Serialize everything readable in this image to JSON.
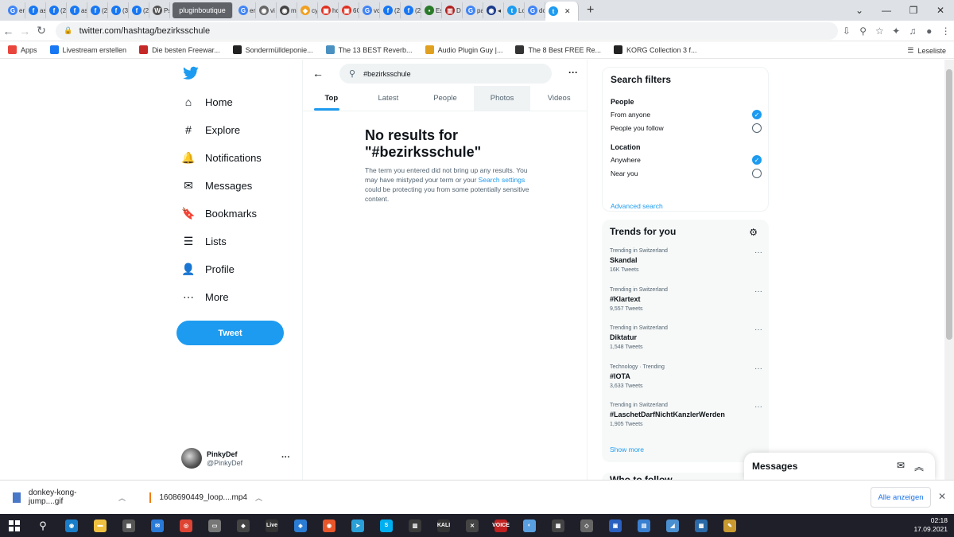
{
  "browser": {
    "tabs": [
      {
        "fav": "G",
        "label": "er",
        "color": "#4285f4"
      },
      {
        "fav": "f",
        "label": "as",
        "color": "#1877f2"
      },
      {
        "fav": "f",
        "label": "(2",
        "color": "#1877f2"
      },
      {
        "fav": "f",
        "label": "as",
        "color": "#1877f2"
      },
      {
        "fav": "f",
        "label": "(2",
        "color": "#1877f2"
      },
      {
        "fav": "f",
        "label": "(3",
        "color": "#1877f2"
      },
      {
        "fav": "f",
        "label": "(2",
        "color": "#1877f2"
      },
      {
        "fav": "W",
        "label": "Ps",
        "color": "#555555"
      }
    ],
    "highlight_tab": "pluginboutique",
    "tabs2": [
      {
        "fav": "G",
        "label": "er",
        "color": "#4285f4"
      },
      {
        "fav": "◉",
        "label": "vi",
        "color": "#666666"
      },
      {
        "fav": "◉",
        "label": "m",
        "color": "#444444"
      },
      {
        "fav": "◆",
        "label": "cy",
        "color": "#f0a020"
      },
      {
        "fav": "▣",
        "label": "hc",
        "color": "#e03020"
      },
      {
        "fav": "▣",
        "label": "6C",
        "color": "#e03020"
      },
      {
        "fav": "G",
        "label": "vc",
        "color": "#4285f4"
      },
      {
        "fav": "f",
        "label": "(2",
        "color": "#1877f2"
      },
      {
        "fav": "f",
        "label": "(2",
        "color": "#1877f2"
      },
      {
        "fav": "▪",
        "label": "Es",
        "color": "#2a7a2a"
      },
      {
        "fav": "▥",
        "label": "D",
        "color": "#b02020"
      },
      {
        "fav": "G",
        "label": "pa",
        "color": "#4285f4"
      },
      {
        "fav": "◉",
        "label": "◂",
        "color": "#1a3a8a"
      },
      {
        "fav": "t",
        "label": "Lo",
        "color": "#1d9bf0"
      },
      {
        "fav": "G",
        "label": "do",
        "color": "#4285f4"
      }
    ],
    "active_tab": {
      "fav": "t",
      "color": "#1d9bf0"
    },
    "url": "twitter.com/hashtag/bezirksschule",
    "bookmarks": [
      {
        "label": "Apps",
        "color": "#e8453c"
      },
      {
        "label": "Livestream erstellen",
        "color": "#1877f2"
      },
      {
        "label": "Die besten Freewar...",
        "color": "#c62828"
      },
      {
        "label": "Sondermülldeponie...",
        "color": "#222222"
      },
      {
        "label": "The 13 BEST Reverb...",
        "color": "#4a90c0"
      },
      {
        "label": "Audio Plugin Guy |...",
        "color": "#e0a020"
      },
      {
        "label": "The 8 Best FREE Re...",
        "color": "#333333"
      },
      {
        "label": "KORG Collection 3 f...",
        "color": "#222222"
      }
    ],
    "reading_list": "Leseliste"
  },
  "sidebar": {
    "nav": [
      {
        "label": "Home",
        "icon": "home-icon",
        "glyph": "⌂"
      },
      {
        "label": "Explore",
        "icon": "hashtag-icon",
        "glyph": "#"
      },
      {
        "label": "Notifications",
        "icon": "bell-icon",
        "glyph": "🔔"
      },
      {
        "label": "Messages",
        "icon": "envelope-icon",
        "glyph": "✉"
      },
      {
        "label": "Bookmarks",
        "icon": "bookmark-icon",
        "glyph": "🔖"
      },
      {
        "label": "Lists",
        "icon": "list-icon",
        "glyph": "☰"
      },
      {
        "label": "Profile",
        "icon": "person-icon",
        "glyph": "👤"
      },
      {
        "label": "More",
        "icon": "more-circle-icon",
        "glyph": "⋯"
      }
    ],
    "tweet_button": "Tweet",
    "account": {
      "name": "PinkyDef",
      "handle": "@PinkyDef"
    }
  },
  "main": {
    "search_value": "#bezirksschule",
    "tabs": [
      "Top",
      "Latest",
      "People",
      "Photos",
      "Videos"
    ],
    "selected_tab": "Top",
    "empty_title": "No results for \"#bezirksschule\"",
    "empty_text_1": "The term you entered did not bring up any results. You may have mistyped your term or your ",
    "empty_link": "Search settings",
    "empty_text_2": " could be protecting you from some potentially sensitive content."
  },
  "filters": {
    "title": "Search filters",
    "people_label": "People",
    "people_options": [
      {
        "label": "From anyone",
        "selected": true
      },
      {
        "label": "People you follow",
        "selected": false
      }
    ],
    "location_label": "Location",
    "location_options": [
      {
        "label": "Anywhere",
        "selected": true
      },
      {
        "label": "Near you",
        "selected": false
      }
    ],
    "advanced": "Advanced search"
  },
  "trends": {
    "title": "Trends for you",
    "items": [
      {
        "context": "Trending in Switzerland",
        "name": "Skandal",
        "count": "16K Tweets"
      },
      {
        "context": "Trending in Switzerland",
        "name": "#Klartext",
        "count": "9,557 Tweets"
      },
      {
        "context": "Trending in Switzerland",
        "name": "Diktatur",
        "count": "1,548 Tweets"
      },
      {
        "context": "Technology · Trending",
        "name": "#IOTA",
        "count": "3,633 Tweets"
      },
      {
        "context": "Trending in Switzerland",
        "name": "#LaschetDarfNichtKanzlerWerden",
        "count": "1,905 Tweets"
      }
    ],
    "show_more": "Show more",
    "who_to_follow": "Who to follow"
  },
  "messages_dock": {
    "title": "Messages"
  },
  "downloads": {
    "items": [
      {
        "name": "donkey-kong-jump....gif",
        "color": "#4a78c8"
      },
      {
        "name": "1608690449_loop....mp4",
        "color": "#f07d00"
      }
    ],
    "show_all": "Alle anzeigen"
  },
  "taskbar": {
    "apps": [
      {
        "g": "◉",
        "c": "#1a7dc8"
      },
      {
        "g": "▬",
        "c": "#f0c040"
      },
      {
        "g": "▦",
        "c": "#555555"
      },
      {
        "g": "✉",
        "c": "#2a7ad8"
      },
      {
        "g": "◎",
        "c": "#dd4433"
      },
      {
        "g": "▭",
        "c": "#777777"
      },
      {
        "g": "◆",
        "c": "#444444"
      },
      {
        "g": "Live",
        "c": "#333333"
      },
      {
        "g": "◈",
        "c": "#2b7cd3"
      },
      {
        "g": "◉",
        "c": "#e8562a"
      },
      {
        "g": "➤",
        "c": "#2aa0d8"
      },
      {
        "g": "S",
        "c": "#00aff0"
      },
      {
        "g": "▥",
        "c": "#3a3a3a"
      },
      {
        "g": "KALI",
        "c": "#333333"
      },
      {
        "g": "✕",
        "c": "#444444"
      },
      {
        "g": "VOICE",
        "c": "#c02020"
      },
      {
        "g": "◐",
        "c": "#5aa0e0"
      },
      {
        "g": "▦",
        "c": "#444444"
      },
      {
        "g": "◇",
        "c": "#666666"
      },
      {
        "g": "▣",
        "c": "#2a60c0"
      },
      {
        "g": "▤",
        "c": "#3a80d0"
      },
      {
        "g": "◢",
        "c": "#4a90d0"
      },
      {
        "g": "▩",
        "c": "#2a6aa8"
      },
      {
        "g": "✎",
        "c": "#c89a30"
      }
    ],
    "time": "02:18",
    "date": "17.09.2021"
  }
}
